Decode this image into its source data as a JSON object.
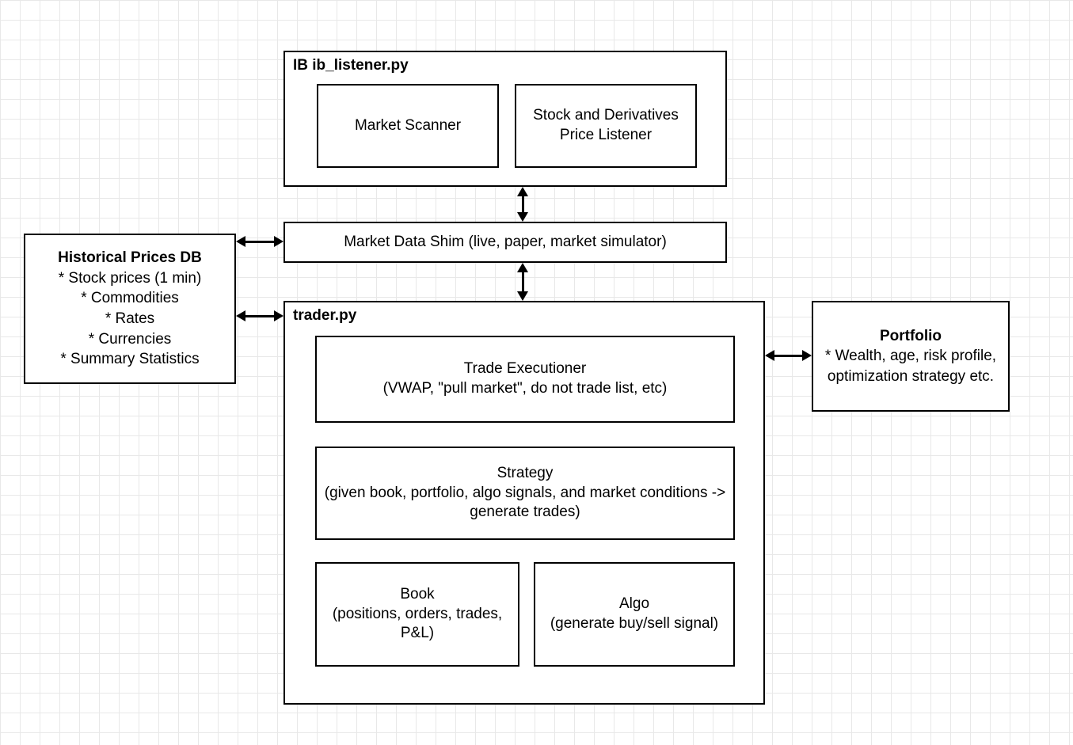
{
  "ib_listener": {
    "title": "IB ib_listener.py",
    "market_scanner": "Market Scanner",
    "price_listener": "Stock and Derivatives Price Listener"
  },
  "market_data_shim": "Market Data Shim (live, paper, market simulator)",
  "historical_db": {
    "title": "Historical Prices DB",
    "items": [
      "* Stock prices (1 min)",
      "* Commodities",
      "* Rates",
      "* Currencies",
      "* Summary Statistics"
    ]
  },
  "portfolio": {
    "title": "Portfolio",
    "body": "* Wealth, age, risk profile, optimization strategy etc."
  },
  "trader": {
    "title": "trader.py",
    "trade_executioner_title": "Trade Executioner",
    "trade_executioner_body": "(VWAP, \"pull market\", do not trade list, etc)",
    "strategy_title": "Strategy",
    "strategy_body": "(given book, portfolio, algo signals, and market conditions -> generate trades)",
    "book_title": "Book",
    "book_body": "(positions, orders, trades, P&L)",
    "algo_title": "Algo",
    "algo_body": "(generate buy/sell signal)"
  }
}
